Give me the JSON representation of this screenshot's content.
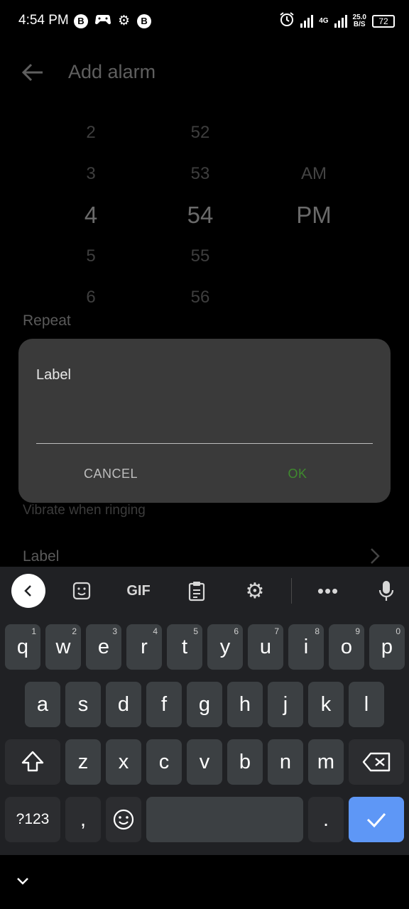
{
  "status_bar": {
    "time": "4:54 PM",
    "left_icons": [
      "b-circle-icon",
      "game-controller-icon",
      "gear-icon",
      "b-circle-icon"
    ],
    "right_icons": [
      "alarm-icon",
      "signal-icon",
      "4g-signal-icon",
      "net-speed",
      "battery-icon"
    ],
    "net_type": "4G",
    "net_speed_value": "25.0",
    "net_speed_unit": "B/S",
    "battery": "72"
  },
  "app": {
    "title": "Add alarm",
    "picker": {
      "hours": [
        "2",
        "3",
        "4",
        "5",
        "6"
      ],
      "minutes": [
        "52",
        "53",
        "54",
        "55",
        "56"
      ],
      "ampm": [
        "AM",
        "PM"
      ],
      "selected_hour": "4",
      "selected_minute": "54",
      "selected_ampm": "PM"
    },
    "repeat_label": "Repeat",
    "vibrate_label": "Vibrate when ringing",
    "label_row": "Label"
  },
  "dialog": {
    "title": "Label",
    "input_value": "",
    "cancel": "CANCEL",
    "ok": "OK",
    "ok_color": "#3f8a2e"
  },
  "keyboard": {
    "toolbar_icons": [
      "chevron-left-icon",
      "sticker-icon",
      "gif-icon",
      "clipboard-icon",
      "gear-icon",
      "more-icon",
      "mic-icon"
    ],
    "gif_label": "GIF",
    "row1": [
      {
        "k": "q",
        "h": "1"
      },
      {
        "k": "w",
        "h": "2"
      },
      {
        "k": "e",
        "h": "3"
      },
      {
        "k": "r",
        "h": "4"
      },
      {
        "k": "t",
        "h": "5"
      },
      {
        "k": "y",
        "h": "6"
      },
      {
        "k": "u",
        "h": "7"
      },
      {
        "k": "i",
        "h": "8"
      },
      {
        "k": "o",
        "h": "9"
      },
      {
        "k": "p",
        "h": "0"
      }
    ],
    "row2": [
      "a",
      "s",
      "d",
      "f",
      "g",
      "h",
      "j",
      "k",
      "l"
    ],
    "row3": [
      "z",
      "x",
      "c",
      "v",
      "b",
      "n",
      "m"
    ],
    "symbols": "?123",
    "comma": ",",
    "period": ".",
    "accent_color": "#5e97f6"
  }
}
